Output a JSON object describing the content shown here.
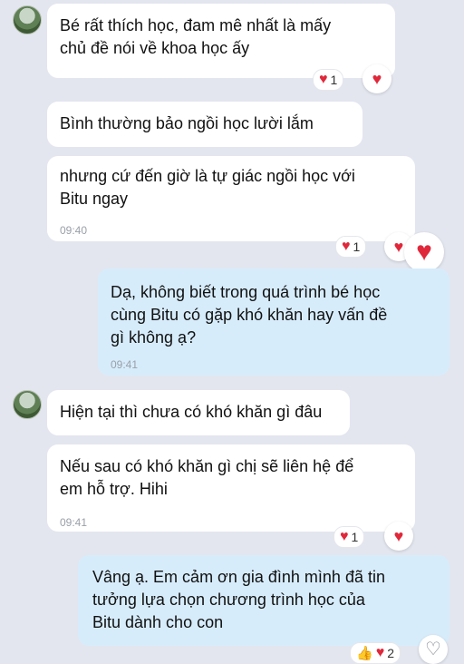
{
  "messages": [
    {
      "text": "Bé rất thích học, đam mê nhất là mấy\nchủ đề nói về khoa học ấy",
      "reaction_count": "1"
    },
    {
      "text": "Bình thường bảo ngồi học lười lắm"
    },
    {
      "text": "nhưng cứ đến giờ là tự giác ngồi học với\nBitu ngay",
      "time": "09:40",
      "reaction_count": "1"
    },
    {
      "text": "Dạ, không biết trong quá trình bé học\ncùng Bitu có gặp khó khăn hay vấn đề\ngì không ạ?",
      "time": "09:41"
    },
    {
      "text": "Hiện tại thì chưa có khó khăn gì đâu"
    },
    {
      "text": "Nếu sau có khó khăn gì chị sẽ liên hệ để\nem hỗ trợ. Hihi",
      "time": "09:41",
      "reaction_count": "1"
    },
    {
      "text": "Vâng ạ. Em cảm ơn gia đình mình đã tin\ntưởng lựa chọn chương trình học của\nBitu dành cho con",
      "reaction_count": "2"
    }
  ],
  "icons": {
    "heart": "♥",
    "heart_outline": "♡",
    "thumbs_up": "👍"
  },
  "colors": {
    "background": "#e3e6ef",
    "incoming_bubble": "#ffffff",
    "outgoing_bubble": "#d7ecfb",
    "heart": "#e0283b"
  }
}
